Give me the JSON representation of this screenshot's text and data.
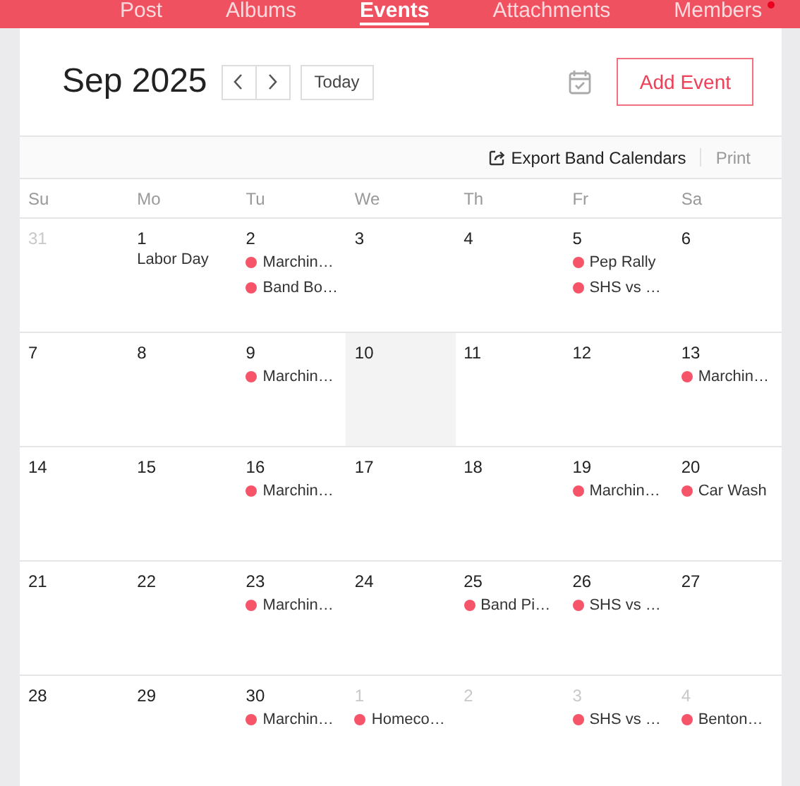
{
  "nav": {
    "tabs": [
      {
        "label": "Post",
        "selected": false,
        "alert": false
      },
      {
        "label": "Albums",
        "selected": false,
        "alert": false
      },
      {
        "label": "Events",
        "selected": true,
        "alert": false
      },
      {
        "label": "Attachments",
        "selected": false,
        "alert": false
      },
      {
        "label": "Members",
        "selected": false,
        "alert": true
      }
    ]
  },
  "header": {
    "month_title": "Sep 2025",
    "today_button": "Today",
    "add_button": "Add Event"
  },
  "toolbar": {
    "export_link": "Export Band Calendars",
    "print_link": "Print"
  },
  "weekdays": [
    "Su",
    "Mo",
    "Tu",
    "We",
    "Th",
    "Fr",
    "Sa"
  ],
  "weeks": [
    [
      {
        "date": "31",
        "in_month": false,
        "today": false
      },
      {
        "date": "1",
        "in_month": true,
        "today": false,
        "events": [
          {
            "kind": "holiday",
            "title": "Labor Day"
          }
        ]
      },
      {
        "date": "2",
        "in_month": true,
        "today": false,
        "events": [
          {
            "kind": "event",
            "title": "Marchin…"
          },
          {
            "kind": "event",
            "title": "Band Bo…"
          }
        ]
      },
      {
        "date": "3",
        "in_month": true,
        "today": false
      },
      {
        "date": "4",
        "in_month": true,
        "today": false
      },
      {
        "date": "5",
        "in_month": true,
        "today": false,
        "events": [
          {
            "kind": "event",
            "title": "Pep Rally"
          },
          {
            "kind": "event",
            "title": "SHS vs …"
          }
        ]
      },
      {
        "date": "6",
        "in_month": true,
        "today": false
      }
    ],
    [
      {
        "date": "7",
        "in_month": true,
        "today": false
      },
      {
        "date": "8",
        "in_month": true,
        "today": false
      },
      {
        "date": "9",
        "in_month": true,
        "today": false,
        "events": [
          {
            "kind": "event",
            "title": "Marchin…"
          }
        ]
      },
      {
        "date": "10",
        "in_month": true,
        "today": true
      },
      {
        "date": "11",
        "in_month": true,
        "today": false
      },
      {
        "date": "12",
        "in_month": true,
        "today": false
      },
      {
        "date": "13",
        "in_month": true,
        "today": false,
        "events": [
          {
            "kind": "event",
            "title": "Marchin…"
          }
        ]
      }
    ],
    [
      {
        "date": "14",
        "in_month": true,
        "today": false
      },
      {
        "date": "15",
        "in_month": true,
        "today": false
      },
      {
        "date": "16",
        "in_month": true,
        "today": false,
        "events": [
          {
            "kind": "event",
            "title": "Marchin…"
          }
        ]
      },
      {
        "date": "17",
        "in_month": true,
        "today": false
      },
      {
        "date": "18",
        "in_month": true,
        "today": false
      },
      {
        "date": "19",
        "in_month": true,
        "today": false,
        "events": [
          {
            "kind": "event",
            "title": "Marchin…"
          }
        ]
      },
      {
        "date": "20",
        "in_month": true,
        "today": false,
        "events": [
          {
            "kind": "event",
            "title": "Car Wash"
          }
        ]
      }
    ],
    [
      {
        "date": "21",
        "in_month": true,
        "today": false
      },
      {
        "date": "22",
        "in_month": true,
        "today": false
      },
      {
        "date": "23",
        "in_month": true,
        "today": false,
        "events": [
          {
            "kind": "event",
            "title": "Marchin…"
          }
        ]
      },
      {
        "date": "24",
        "in_month": true,
        "today": false
      },
      {
        "date": "25",
        "in_month": true,
        "today": false,
        "events": [
          {
            "kind": "event",
            "title": "Band Pi…"
          }
        ]
      },
      {
        "date": "26",
        "in_month": true,
        "today": false,
        "events": [
          {
            "kind": "event",
            "title": "SHS vs …"
          }
        ]
      },
      {
        "date": "27",
        "in_month": true,
        "today": false
      }
    ],
    [
      {
        "date": "28",
        "in_month": true,
        "today": false
      },
      {
        "date": "29",
        "in_month": true,
        "today": false
      },
      {
        "date": "30",
        "in_month": true,
        "today": false,
        "events": [
          {
            "kind": "event",
            "title": "Marchin…"
          }
        ]
      },
      {
        "date": "1",
        "in_month": false,
        "today": false,
        "events": [
          {
            "kind": "event",
            "title": "Homeco…"
          }
        ]
      },
      {
        "date": "2",
        "in_month": false,
        "today": false
      },
      {
        "date": "3",
        "in_month": false,
        "today": false,
        "events": [
          {
            "kind": "event",
            "title": "SHS vs …"
          }
        ]
      },
      {
        "date": "4",
        "in_month": false,
        "today": false,
        "events": [
          {
            "kind": "event",
            "title": "Benton…"
          }
        ]
      }
    ]
  ]
}
